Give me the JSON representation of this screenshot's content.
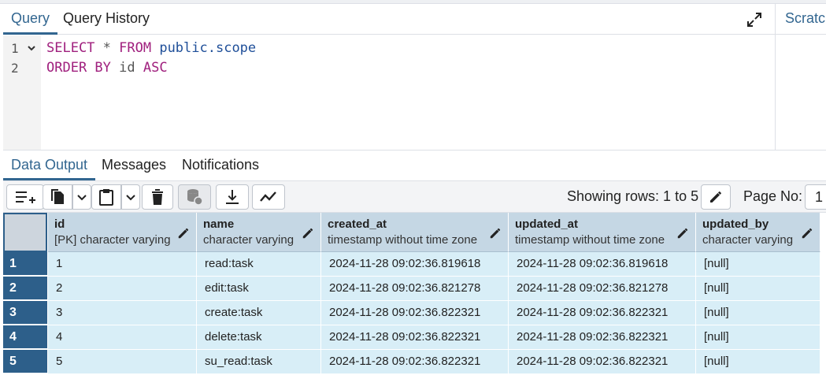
{
  "query_tabs": {
    "query": "Query",
    "history": "Query History"
  },
  "scratch_label": "Scratch Pad",
  "editor": {
    "lines": [
      {
        "num": "1",
        "kw1": "SELECT",
        "op": " * ",
        "kw2": "FROM",
        "ident": " public.scope"
      },
      {
        "num": "2",
        "kw1": "ORDER BY",
        "op": " id ",
        "kw2": "ASC",
        "ident": ""
      }
    ]
  },
  "result_tabs": {
    "data_output": "Data Output",
    "messages": "Messages",
    "notifications": "Notifications"
  },
  "toolbar": {
    "showing_rows": "Showing rows: 1 to 5",
    "page_no_label": "Page No:",
    "page_no_value": "1"
  },
  "columns": [
    {
      "name": "id",
      "type": "[PK] character varying"
    },
    {
      "name": "name",
      "type": "character varying"
    },
    {
      "name": "created_at",
      "type": "timestamp without time zone"
    },
    {
      "name": "updated_at",
      "type": "timestamp without time zone"
    },
    {
      "name": "updated_by",
      "type": "character varying"
    }
  ],
  "rows": [
    {
      "rownum": "1",
      "id": "1",
      "name": "read:task",
      "created_at": "2024-11-28 09:02:36.819618",
      "updated_at": "2024-11-28 09:02:36.819618",
      "updated_by": "[null]"
    },
    {
      "rownum": "2",
      "id": "2",
      "name": "edit:task",
      "created_at": "2024-11-28 09:02:36.821278",
      "updated_at": "2024-11-28 09:02:36.821278",
      "updated_by": "[null]"
    },
    {
      "rownum": "3",
      "id": "3",
      "name": "create:task",
      "created_at": "2024-11-28 09:02:36.822321",
      "updated_at": "2024-11-28 09:02:36.822321",
      "updated_by": "[null]"
    },
    {
      "rownum": "4",
      "id": "4",
      "name": "delete:task",
      "created_at": "2024-11-28 09:02:36.822321",
      "updated_at": "2024-11-28 09:02:36.822321",
      "updated_by": "[null]"
    },
    {
      "rownum": "5",
      "id": "5",
      "name": "su_read:task",
      "created_at": "2024-11-28 09:02:36.822321",
      "updated_at": "2024-11-28 09:02:36.822321",
      "updated_by": "[null]"
    }
  ],
  "colors": {
    "accent": "#326690",
    "row_bg": "#d8eef7",
    "rownum_bg": "#2d5f8a",
    "header_bg": "#c5d7e4"
  },
  "icons": [
    "expand-icon",
    "add-row-icon",
    "copy-icon",
    "chevron-down-icon",
    "paste-icon",
    "delete-icon",
    "save-data-icon",
    "download-icon",
    "graph-icon",
    "edit-pencil-icon",
    "fold-chevron-icon"
  ]
}
